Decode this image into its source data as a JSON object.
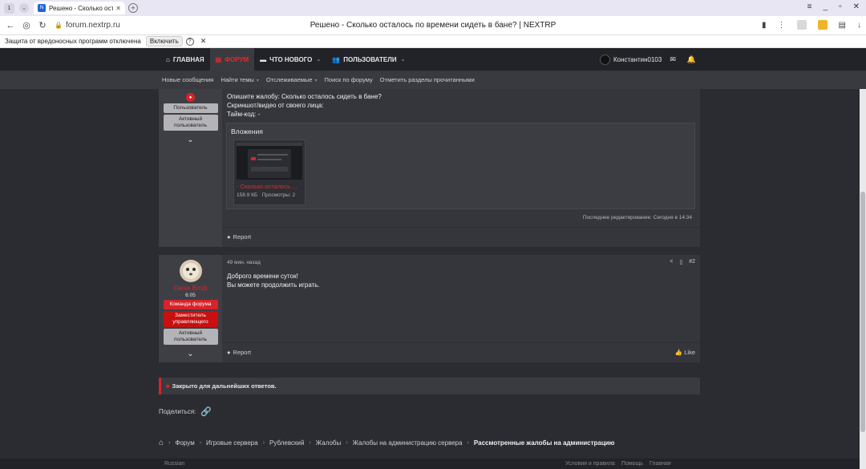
{
  "browser": {
    "tab_count": "1",
    "tab_title": "Решено - Сколько оста",
    "url": "forum.nextrp.ru",
    "page_title": "Решено - Сколько осталось по времени сидеть в бане? | NEXTRP",
    "protection_text": "Защита от вредоносных программ отключена",
    "protection_button": "Включить"
  },
  "nav": {
    "items": [
      {
        "label": "ГЛАВНАЯ",
        "icon": "home-icon"
      },
      {
        "label": "ФОРУМ",
        "icon": "forum-icon"
      },
      {
        "label": "ЧТО НОВОГО",
        "icon": "chat-icon"
      },
      {
        "label": "ПОЛЬЗОВАТЕЛИ",
        "icon": "users-icon"
      }
    ],
    "username": "Константин0103"
  },
  "subnav": {
    "items": [
      "Новые сообщения",
      "Найти темы",
      "Отслеживаемые",
      "Поиск по форуму",
      "Отметить разделы прочитанными"
    ]
  },
  "post1": {
    "user_badges": [
      "Пользователь",
      "Активный пользователь"
    ],
    "lines": [
      "Опишите жалобу: Сколько осталось сидеть в бане?",
      "Скриншот/видео от своего лица:",
      "Тайм-код: -"
    ],
    "attachments_title": "Вложения",
    "attachment": {
      "name": "- Сколько осталось ...",
      "size": "158.9 КБ",
      "views": "Просмотры: 2"
    },
    "last_edit": "Последнее редактирование: Сегодня в 14:34",
    "report": "Report"
  },
  "post2": {
    "username": "Denis Brodi",
    "user_title": "6:05",
    "badges": [
      "Команда форума",
      "Заместитель управляющего",
      "Активный пользователь"
    ],
    "time": "49 мин. назад",
    "number": "#2",
    "lines": [
      "Доброго времени суток!",
      "Вы можете продолжить играть."
    ],
    "report": "Report",
    "like": "Like"
  },
  "closed_notice": "Закрыто для дальнейших ответов.",
  "share_label": "Поделиться:",
  "breadcrumbs": [
    "Форум",
    "Игровые сервера",
    "Рублевский",
    "Жалобы",
    "Жалобы на администрацию сервера",
    "Рассмотренные жалобы на администрацию"
  ],
  "footer": {
    "language": "Russian",
    "links": [
      "Условия и правила",
      "Помощь",
      "Главная"
    ]
  },
  "colors": {
    "accent": "#d8232a",
    "bg": "#2b2c31",
    "panel": "#35363c",
    "nav": "#222328"
  }
}
